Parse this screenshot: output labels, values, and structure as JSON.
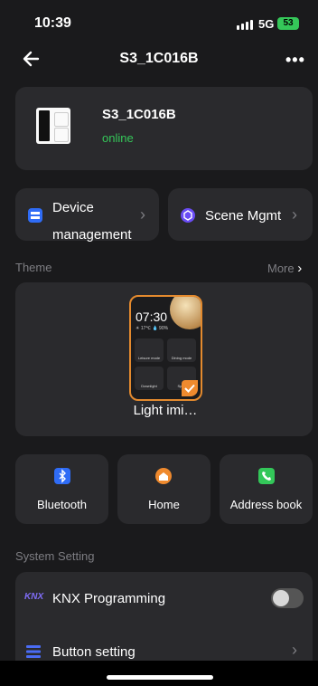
{
  "status": {
    "time": "10:39",
    "network": "5G",
    "battery": "53"
  },
  "nav": {
    "title": "S3_1C016B",
    "back_icon": "back-arrow-icon",
    "more_icon": "more-icon"
  },
  "device": {
    "name": "S3_1C016B",
    "status": "online"
  },
  "tiles": {
    "device_mgmt": {
      "line1": "Device",
      "line2": "management"
    },
    "scene_mgmt": {
      "label": "Scene Mgmt"
    }
  },
  "theme": {
    "heading": "Theme",
    "more": "More",
    "name": "Light imi…",
    "preview": {
      "time": "07:30",
      "info": "☀ 17℃  💧 90%",
      "cells": [
        "Leisure mode",
        "Dining mode",
        "Downlight",
        "Spotl"
      ]
    }
  },
  "quick": [
    {
      "label": "Bluetooth",
      "icon": "bluetooth-icon"
    },
    {
      "label": "Home",
      "icon": "home-icon"
    },
    {
      "label": "Address book",
      "icon": "phone-icon"
    }
  ],
  "system": {
    "heading": "System Setting",
    "knx": {
      "label": "KNX Programming",
      "enabled": false
    },
    "button_setting": {
      "label": "Button setting"
    }
  },
  "colors": {
    "accent": "#e48a2e",
    "online": "#35c759",
    "blue": "#2f6cf6",
    "purple": "#6a4cf5",
    "green": "#33c759"
  }
}
